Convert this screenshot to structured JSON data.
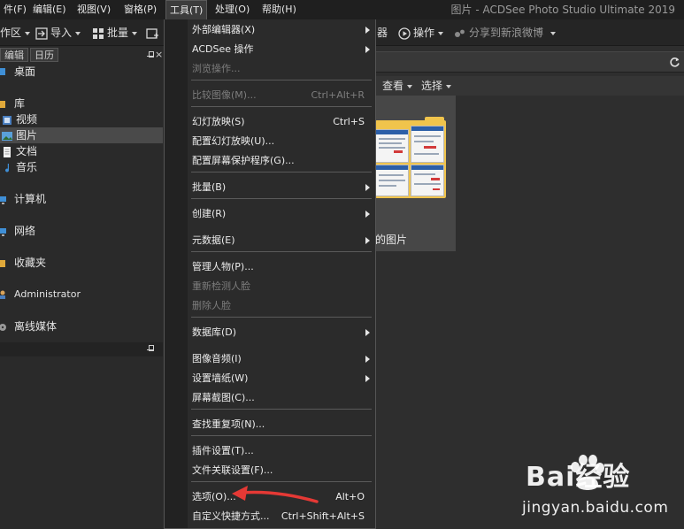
{
  "app": {
    "title": "图片 - ACDSee Photo Studio Ultimate 2019"
  },
  "menubar": {
    "items": [
      "件(F)",
      "编辑(E)",
      "视图(V)",
      "窗格(P)",
      "工具(T)",
      "处理(O)",
      "帮助(H)"
    ],
    "active": "工具(T)"
  },
  "toolbar": {
    "workspace": "作区",
    "import": "导入",
    "batch": "批量",
    "partial_label": "器",
    "actions": "操作",
    "share": "分享到新浪微博"
  },
  "left_panel": {
    "tabs": [
      "编辑",
      "日历"
    ],
    "tree": [
      "桌面",
      "库",
      "视频",
      "图片",
      "文档",
      "音乐",
      "计算机",
      "网络",
      "收藏夹",
      "Administrator",
      "离线媒体"
    ],
    "selected": "图片"
  },
  "main": {
    "view_label": "查看",
    "select_label": "选择",
    "thumb_label": "的图片"
  },
  "tools_menu": {
    "items": [
      {
        "label": "外部编辑器(X)",
        "shortcut": "",
        "submenu": true,
        "disabled": false
      },
      {
        "label": "ACDSee 操作",
        "shortcut": "",
        "submenu": true,
        "disabled": false
      },
      {
        "label": "浏览操作...",
        "shortcut": "",
        "submenu": false,
        "disabled": true
      },
      {
        "label": "比较图像(M)...",
        "shortcut": "Ctrl+Alt+R",
        "submenu": false,
        "disabled": true
      },
      {
        "label": "幻灯放映(S)",
        "shortcut": "Ctrl+S",
        "submenu": false,
        "disabled": false
      },
      {
        "label": "配置幻灯放映(U)...",
        "shortcut": "",
        "submenu": false,
        "disabled": false
      },
      {
        "label": "配置屏幕保护程序(G)...",
        "shortcut": "",
        "submenu": false,
        "disabled": false
      },
      {
        "label": "批量(B)",
        "shortcut": "",
        "submenu": true,
        "disabled": false
      },
      {
        "label": "创建(R)",
        "shortcut": "",
        "submenu": true,
        "disabled": false
      },
      {
        "label": "元数据(E)",
        "shortcut": "",
        "submenu": true,
        "disabled": false
      },
      {
        "label": "管理人物(P)...",
        "shortcut": "",
        "submenu": false,
        "disabled": false
      },
      {
        "label": "重新检测人脸",
        "shortcut": "",
        "submenu": false,
        "disabled": true
      },
      {
        "label": "删除人脸",
        "shortcut": "",
        "submenu": false,
        "disabled": true
      },
      {
        "label": "数据库(D)",
        "shortcut": "",
        "submenu": true,
        "disabled": false
      },
      {
        "label": "图像音频(I)",
        "shortcut": "",
        "submenu": true,
        "disabled": false
      },
      {
        "label": "设置墙纸(W)",
        "shortcut": "",
        "submenu": true,
        "disabled": false
      },
      {
        "label": "屏幕截图(C)...",
        "shortcut": "",
        "submenu": false,
        "disabled": false
      },
      {
        "label": "查找重复项(N)...",
        "shortcut": "",
        "submenu": false,
        "disabled": false
      },
      {
        "label": "插件设置(T)...",
        "shortcut": "",
        "submenu": false,
        "disabled": false
      },
      {
        "label": "文件关联设置(F)...",
        "shortcut": "",
        "submenu": false,
        "disabled": false
      },
      {
        "label": "选项(O)...",
        "shortcut": "Alt+O",
        "submenu": false,
        "disabled": false
      },
      {
        "label": "自定义快捷方式...",
        "shortcut": "Ctrl+Shift+Alt+S",
        "submenu": false,
        "disabled": false
      }
    ]
  },
  "watermark": {
    "logo": "Bai经验",
    "url": "jingyan.baidu.com"
  },
  "colors": {
    "annotation_arrow": "#e53935",
    "folder": "#f0c44c",
    "menu_bg": "#2b2b2b"
  }
}
